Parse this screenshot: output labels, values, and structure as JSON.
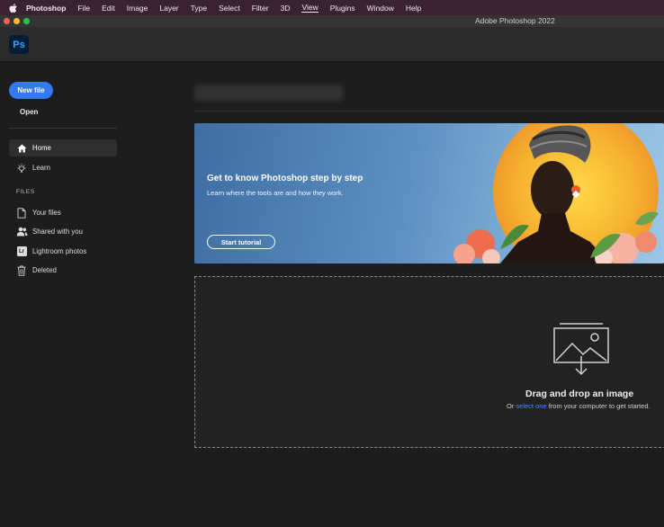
{
  "menubar": {
    "items": [
      "Photoshop",
      "File",
      "Edit",
      "Image",
      "Layer",
      "Type",
      "Select",
      "Filter",
      "3D",
      "View",
      "Plugins",
      "Window",
      "Help"
    ],
    "active": "View"
  },
  "window": {
    "title": "Adobe Photoshop 2022"
  },
  "app": {
    "logo": "Ps"
  },
  "sidebar": {
    "new_file": "New file",
    "open": "Open",
    "nav": [
      {
        "label": "Home",
        "icon": "home-icon",
        "active": true
      },
      {
        "label": "Learn",
        "icon": "lightbulb-icon",
        "active": false
      }
    ],
    "files_section": "FILES",
    "files": [
      {
        "label": "Your files",
        "icon": "file-icon"
      },
      {
        "label": "Shared with you",
        "icon": "people-icon"
      },
      {
        "label": "Lightroom photos",
        "icon": "lightroom-icon",
        "glyph": "Lr"
      },
      {
        "label": "Deleted",
        "icon": "trash-icon"
      }
    ]
  },
  "banner": {
    "headline": "Get to know Photoshop step by step",
    "subtext": "Learn where the tools are and how they work.",
    "button": "Start tutorial"
  },
  "dropzone": {
    "title": "Drag and drop an image",
    "prefix": "Or ",
    "link": "select one",
    "suffix": " from your computer to get started."
  },
  "colors": {
    "accent": "#3478f6",
    "menubar_bg": "#3a2233",
    "link": "#3f8ef5",
    "ps_logo_bg": "#001e36",
    "ps_logo_fg": "#31a8ff"
  }
}
